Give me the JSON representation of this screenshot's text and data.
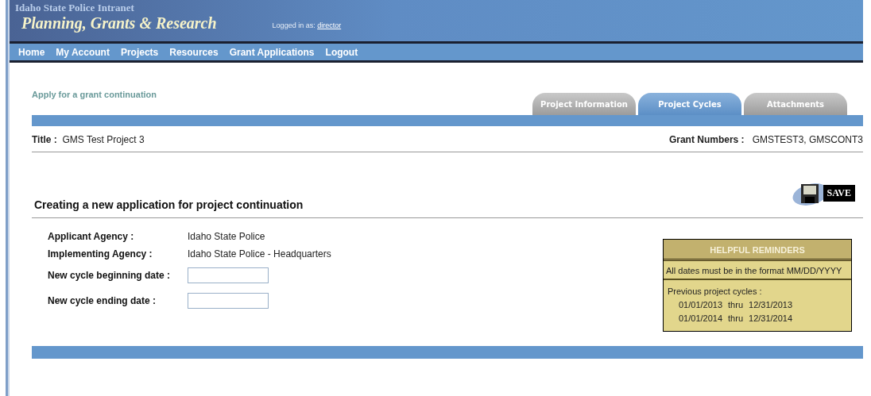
{
  "header": {
    "org": "Idaho State Police Intranet",
    "title": "Planning, Grants & Research",
    "logged_in_label": "Logged in as:",
    "user": "director"
  },
  "nav": [
    "Home",
    "My Account",
    "Projects",
    "Resources",
    "Grant Applications",
    "Logout"
  ],
  "page_title": "Apply for a grant continuation",
  "tabs": [
    {
      "label": "Project Information",
      "selected": false
    },
    {
      "label": "Project Cycles",
      "selected": true
    },
    {
      "label": "Attachments",
      "selected": false
    }
  ],
  "project": {
    "title_label": "Title :",
    "title": "GMS Test Project 3",
    "grants_label": "Grant Numbers :",
    "grants": "GMSTEST3, GMSCONT3"
  },
  "save_label": "SAVE",
  "heading": "Creating a new application for project continuation",
  "fields": [
    {
      "kind": "text",
      "label": "Applicant Agency :",
      "value": "Idaho State Police"
    },
    {
      "kind": "text",
      "label": "Implementing Agency :",
      "value": "Idaho State Police - Headquarters"
    },
    {
      "kind": "input",
      "label": "New cycle beginning date :"
    },
    {
      "kind": "input",
      "label": "New cycle ending date :"
    }
  ],
  "reminders": {
    "title": "HELPFUL REMINDERS",
    "note": "All dates must be in the format MM/DD/YYYY",
    "cycles_label": "Previous project cycles :",
    "cycles": [
      {
        "start": "01/01/2013",
        "sep": "thru",
        "end": "12/31/2013"
      },
      {
        "start": "01/01/2014",
        "sep": "thru",
        "end": "12/31/2014"
      }
    ]
  }
}
